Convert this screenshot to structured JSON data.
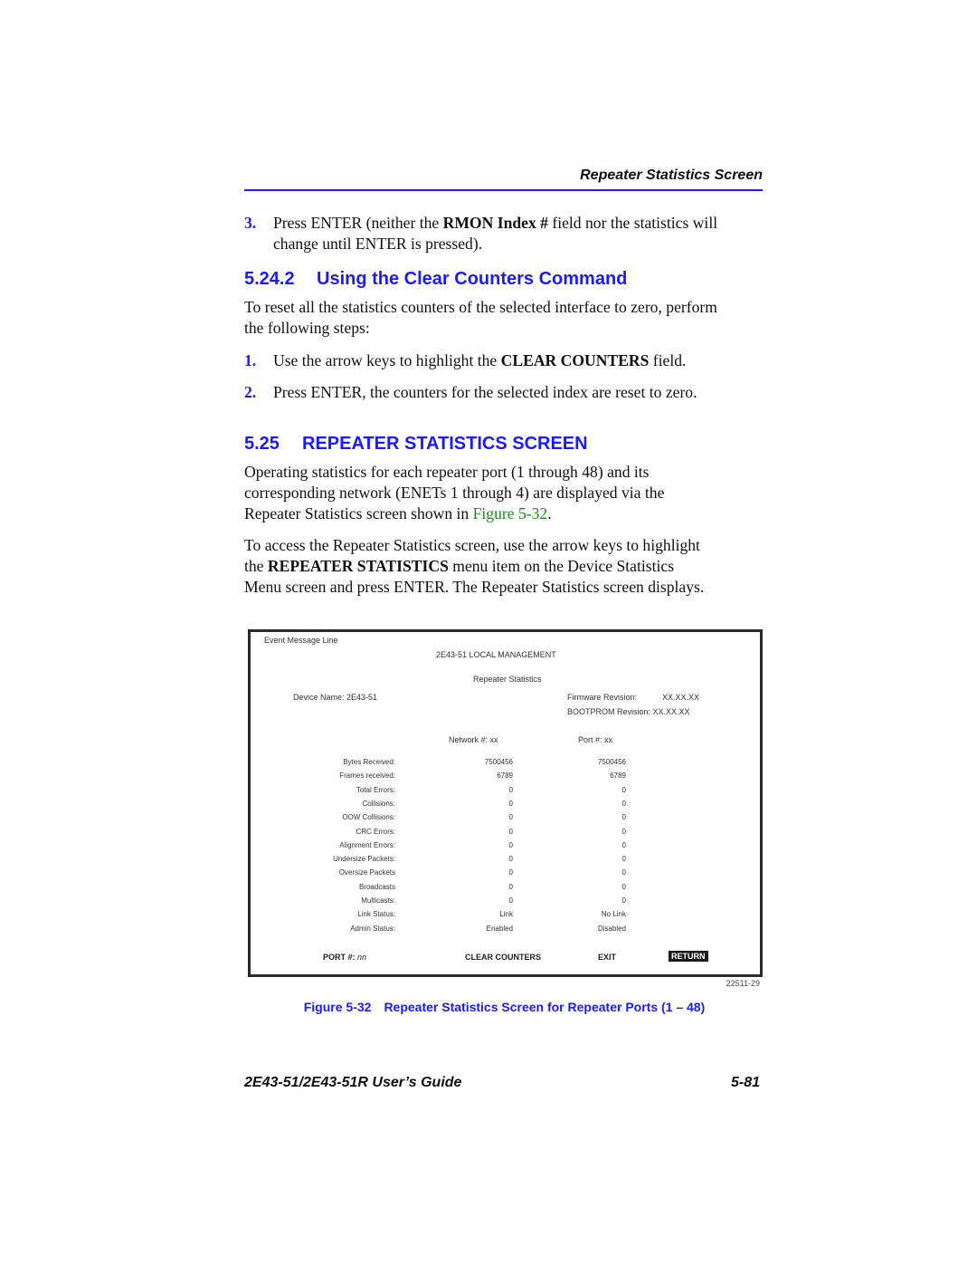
{
  "header": {
    "running_title": "Repeater Statistics Screen"
  },
  "step3": {
    "number": "3.",
    "text_before": "Press ENTER (neither the ",
    "bold": "RMON Index #",
    "text_after_line1": " field nor the statistics will",
    "line2": "change until ENTER is pressed)."
  },
  "section_5_24_2": {
    "number": "5.24.2",
    "title": "Using the Clear Counters Command",
    "intro_line1": "To reset all the statistics counters of the selected interface to zero, perform",
    "intro_line2": "the following steps:",
    "steps": [
      {
        "number": "1.",
        "before": "Use the arrow keys to highlight the ",
        "bold": "CLEAR COUNTERS",
        "after": " field."
      },
      {
        "number": "2.",
        "text": "Press ENTER, the counters for the selected index are reset to zero."
      }
    ]
  },
  "section_5_25": {
    "number": "5.25",
    "title": "REPEATER STATISTICS SCREEN",
    "para1_line1": "Operating statistics for each repeater port (1 through 48) and its",
    "para1_line2": "corresponding network (ENETs 1 through 4) are displayed via the",
    "para1_line3_before": "Repeater Statistics screen shown in ",
    "para1_xref": "Figure 5-32",
    "para1_line3_after": ".",
    "para2_line1": "To access the Repeater Statistics screen, use the arrow keys to highlight",
    "para2_line2_before": "the ",
    "para2_line2_bold": "REPEATER STATISTICS",
    "para2_line2_after": " menu item on the Device Statistics",
    "para2_line3": "Menu screen and press ENTER. The Repeater Statistics screen displays."
  },
  "screen": {
    "event_line": "Event Message Line",
    "title": "2E43-51 LOCAL MANAGEMENT",
    "subtitle": "Repeater Statistics",
    "device_name": "Device Name: 2E43-51",
    "firmware_label": "Firmware Revision:",
    "firmware_value": "XX.XX.XX",
    "bootprom": "BOOTPROM Revision: XX.XX.XX",
    "network_header": "Network #:  xx",
    "port_header": "Port #:  xx",
    "rows": [
      {
        "label": "Bytes Received:",
        "network": "7500456",
        "port": "7500456"
      },
      {
        "label": "Frames received:",
        "network": "6789",
        "port": "6789"
      },
      {
        "label": "Total Errors:",
        "network": "0",
        "port": "0"
      },
      {
        "label": "Collisions:",
        "network": "0",
        "port": "0"
      },
      {
        "label": "OOW Collisions:",
        "network": "0",
        "port": "0"
      },
      {
        "label": "CRC Errors:",
        "network": "0",
        "port": "0"
      },
      {
        "label": "Alignment  Errors:",
        "network": "0",
        "port": "0"
      },
      {
        "label": "Undersize Packets:",
        "network": "0",
        "port": "0"
      },
      {
        "label": "Oversize Packets",
        "network": "0",
        "port": "0"
      },
      {
        "label": "Broadcasts",
        "network": "0",
        "port": "0"
      },
      {
        "label": "Multicasts:",
        "network": "0",
        "port": "0"
      },
      {
        "label": "Link Status:",
        "network": "Link",
        "port": "No Link"
      },
      {
        "label": "Admin Status:",
        "network": "Enabled",
        "port": "Disabled"
      }
    ],
    "commands": {
      "port_label": "PORT #: ",
      "port_value": "nn",
      "clear_counters": "CLEAR COUNTERS",
      "exit": "EXIT",
      "return": "RETURN"
    }
  },
  "figure": {
    "id": "22511-29",
    "caption_number": "Figure 5-32",
    "caption_text": "Repeater Statistics Screen for Repeater Ports (1 – 48)"
  },
  "footer": {
    "guide_title": "2E43-51/2E43-51R User’s Guide",
    "page_number": "5-81"
  }
}
